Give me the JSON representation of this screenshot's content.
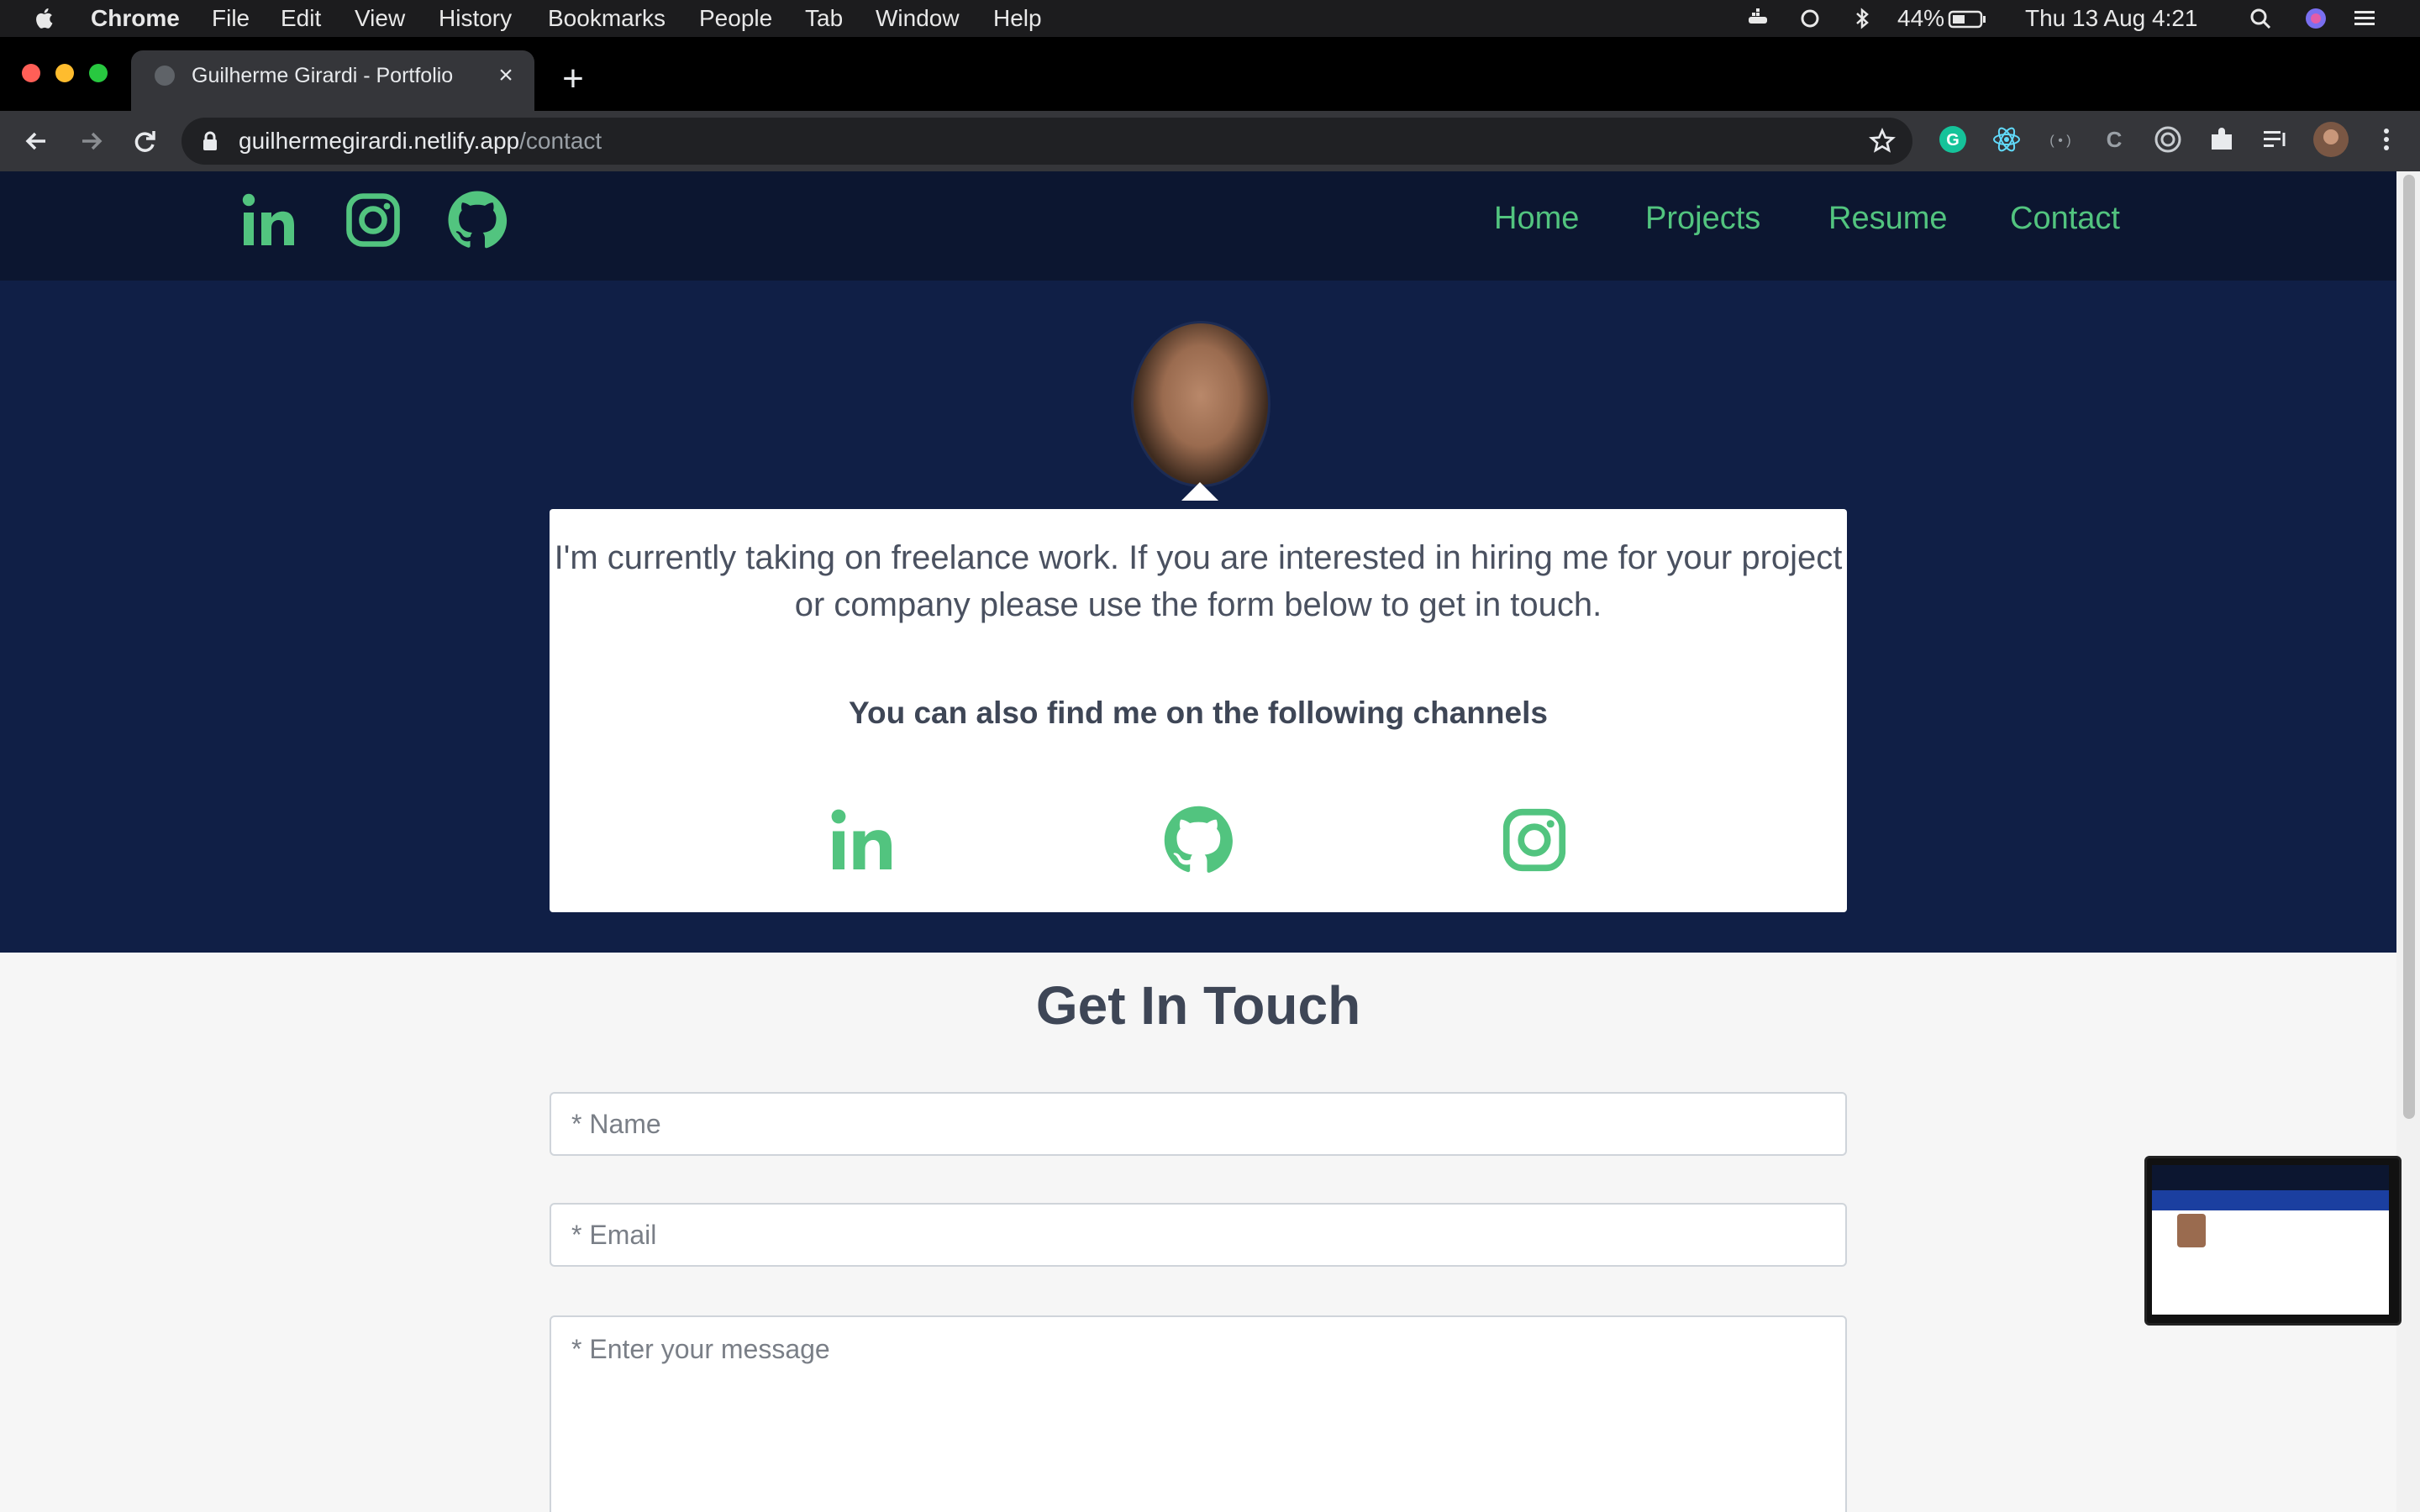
{
  "menubar": {
    "app": "Chrome",
    "items": [
      "File",
      "Edit",
      "View",
      "History",
      "Bookmarks",
      "People",
      "Tab",
      "Window",
      "Help"
    ],
    "battery": "44%",
    "datetime": "Thu 13 Aug  4:21"
  },
  "browser": {
    "tab_title": "Guilherme Girardi - Portfolio",
    "url_host": "guilhermegirardi.netlify.app",
    "url_path": "/contact"
  },
  "site": {
    "nav": [
      "Home",
      "Projects",
      "Resume",
      "Contact"
    ],
    "accent": "#52c47f",
    "nav_bg": "#0c1630",
    "hero_bg": "#101f46"
  },
  "hero": {
    "intro": "I'm currently taking on freelance work. If you are interested in hiring me for your project or company please use the form below to get in touch.",
    "channels_heading": "You can also find me on the following channels",
    "channels": [
      "linkedin-icon",
      "github-icon",
      "instagram-icon"
    ]
  },
  "contact_form": {
    "title": "Get In Touch",
    "name_placeholder": "* Name",
    "email_placeholder": "* Email",
    "message_placeholder": "* Enter your message"
  }
}
